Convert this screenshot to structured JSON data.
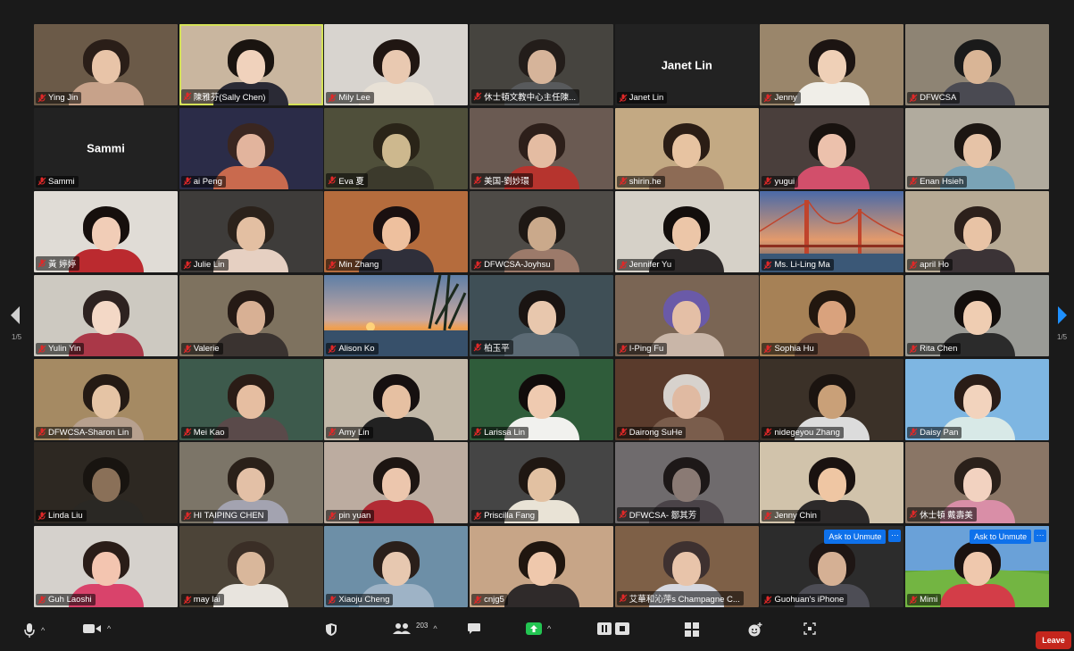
{
  "colors": {
    "active_speaker_border": "#d4e157",
    "unmute_blue": "#0e71eb",
    "leave_red": "#c4261d",
    "muted_mic_red": "#e02828"
  },
  "pagination": {
    "left_page": "1/5",
    "right_page": "1/5"
  },
  "participants": [
    {
      "name": "Ying Jin",
      "bg": "#6b5a48",
      "skin": "#e8c4a8",
      "hair": "#2a1e18",
      "shirt": "#c7a28a"
    },
    {
      "name": "陳雅芬(Sally Chen)",
      "bg": "#c9b69f",
      "skin": "#f0d2bc",
      "hair": "#1a1410",
      "shirt": "#2a2a35",
      "active": true
    },
    {
      "name": "Mily Lee",
      "bg": "#d8d4cf",
      "skin": "#e9c9b1",
      "hair": "#201612",
      "shirt": "#e8e1d6"
    },
    {
      "name": "休士頓文教中心主任陳...",
      "bg": "#46443f",
      "skin": "#d6b49a",
      "hair": "#231d1a",
      "shirt": "#585a5c"
    },
    {
      "name": "Janet Lin",
      "bg": "#222222",
      "center_name": "Janet Lin",
      "no_video": true
    },
    {
      "name": "Jenny",
      "bg": "#9a866b",
      "skin": "#efd0b7",
      "hair": "#1c1412",
      "shirt": "#f0eee8"
    },
    {
      "name": "DFWCSA",
      "bg": "#8e8474",
      "skin": "#d9b596",
      "hair": "#1a1a1a",
      "shirt": "#4a4a52"
    },
    {
      "name": "Sammi",
      "bg": "#222222",
      "center_name": "Sammi",
      "no_video": true
    },
    {
      "name": "ai Peng",
      "bg": "#2b2c48",
      "skin": "#e2b49d",
      "hair": "#3a2620",
      "shirt": "#c96a4e"
    },
    {
      "name": "Eva 夏",
      "bg": "#4f4f3a",
      "skin": "#cdb88e",
      "hair": "#2a2418",
      "shirt": "#3c3a2c"
    },
    {
      "name": "美国-劉妙環",
      "bg": "#6a5a52",
      "skin": "#e4bca2",
      "hair": "#2d1f1a",
      "shirt": "#b6342e"
    },
    {
      "name": "shirin.he",
      "bg": "#c3a983",
      "skin": "#e7c3a1",
      "hair": "#2b1d15",
      "shirt": "#8d6b55"
    },
    {
      "name": "yugui",
      "bg": "#4a3f3c",
      "skin": "#ecc1ac",
      "hair": "#18120f",
      "shirt": "#d24f6b"
    },
    {
      "name": "Enan Hsieh",
      "bg": "#b1ab9e",
      "skin": "#e6c3a7",
      "hair": "#1c1612",
      "shirt": "#7aa3b6"
    },
    {
      "name": "黃 婷婷",
      "bg": "#e0dcd6",
      "skin": "#f1cdb7",
      "hair": "#160f0d",
      "shirt": "#bb2a2f"
    },
    {
      "name": "Julie Lin",
      "bg": "#3e3c3a",
      "skin": "#e3bfa2",
      "hair": "#2b221b",
      "shirt": "#e6d0c2"
    },
    {
      "name": "Min Zhang",
      "bg": "#b56c3d",
      "skin": "#eec09e",
      "hair": "#1a1010",
      "shirt": "#2f2f3a"
    },
    {
      "name": "DFWCSA-Joyhsu",
      "bg": "#4e4b47",
      "skin": "#caa98b",
      "hair": "#1e1814",
      "shirt": "#9c7a6a"
    },
    {
      "name": "Jennifer Yu",
      "bg": "#d6d1c8",
      "skin": "#ecc6a8",
      "hair": "#130e0c",
      "shirt": "#2e2a2a"
    },
    {
      "name": "Ms. Li-Ling Ma",
      "bg": "#5d6f8e",
      "scenery": "bridge"
    },
    {
      "name": "april Ho",
      "bg": "#b7aa95",
      "skin": "#e8c3a5",
      "hair": "#2c201b",
      "shirt": "#3b3336"
    },
    {
      "name": "Yulin Yin",
      "bg": "#cdc9c1",
      "skin": "#f3d8c6",
      "hair": "#2d2220",
      "shirt": "#aa3848"
    },
    {
      "name": "Valerie",
      "bg": "#7e725f",
      "skin": "#d8b094",
      "hair": "#251a15",
      "shirt": "#3a3330"
    },
    {
      "name": "Alison Ko",
      "bg": "#8b95a7",
      "scenery": "sunset"
    },
    {
      "name": "柏玉平",
      "bg": "#3f4f56",
      "skin": "#e8c7ad",
      "hair": "#1a1412",
      "shirt": "#5b6a74"
    },
    {
      "name": "I-Ping Fu",
      "bg": "#7a6554",
      "skin": "#e4bfa6",
      "hair": "#6a5aa8",
      "shirt": "#c9b6a8"
    },
    {
      "name": "Sophia Hu",
      "bg": "#a68156",
      "skin": "#d9a27d",
      "hair": "#22170f",
      "shirt": "#6b4a3a"
    },
    {
      "name": "Rita Chen",
      "bg": "#9a9b96",
      "skin": "#efcdb2",
      "hair": "#130e0c",
      "shirt": "#2b2b2b"
    },
    {
      "name": "DFWCSA-Sharon Lin",
      "bg": "#a58a63",
      "skin": "#e5c4a5",
      "hair": "#241a14",
      "shirt": "#b7a08e"
    },
    {
      "name": "Mei Kao",
      "bg": "#3d5a4c",
      "skin": "#e6bea1",
      "hair": "#2a1c16",
      "shirt": "#5a4a4a"
    },
    {
      "name": "Amy Lin",
      "bg": "#c2b8a8",
      "skin": "#e6c0a2",
      "hair": "#161010",
      "shirt": "#222222"
    },
    {
      "name": "Larissa Lin",
      "bg": "#2f5c3a",
      "skin": "#efcab0",
      "hair": "#110c0b",
      "shirt": "#f1f1ee"
    },
    {
      "name": "Dairong SuHe",
      "bg": "#5a3b2c",
      "skin": "#e0baa2",
      "hair": "#d7d2cd",
      "shirt": "#7a5d4c"
    },
    {
      "name": "nidegeyou Zhang",
      "bg": "#3b3128",
      "skin": "#c9a078",
      "hair": "#1b1410",
      "shirt": "#dcdcdc"
    },
    {
      "name": "Daisy Pan",
      "bg": "#7eb6e2",
      "skin": "#f2d3bd",
      "hair": "#2a1c17",
      "shirt": "#d8e9e7"
    },
    {
      "name": "Linda Liu",
      "bg": "#2d2822",
      "skin": "#8a7058",
      "hair": "#181410",
      "shirt": "#2a2824"
    },
    {
      "name": "HI TAIPING CHEN",
      "bg": "#7c7568",
      "skin": "#e3c0a6",
      "hair": "#2a2019",
      "shirt": "#a3a3b0"
    },
    {
      "name": "pin yuan",
      "bg": "#bcaca0",
      "skin": "#ecc6ad",
      "hair": "#1d1512",
      "shirt": "#b22b34"
    },
    {
      "name": "Priscilla Fang",
      "bg": "#454545",
      "skin": "#e2c1a2",
      "hair": "#1f1712",
      "shirt": "#e9e3d6"
    },
    {
      "name": "DFWCSA- 鄒其芳",
      "bg": "#6f6b6d",
      "skin": "#8a7a74",
      "hair": "#1d1818",
      "shirt": "#4a4348"
    },
    {
      "name": "Jenny Chin",
      "bg": "#d1c3ab",
      "skin": "#efc6a3",
      "hair": "#1a1210",
      "shirt": "#2d2a2a"
    },
    {
      "name": "休士頓 戴壽美",
      "bg": "#8a7666",
      "skin": "#f2d2c0",
      "hair": "#2a201a",
      "shirt": "#d98ea7"
    },
    {
      "name": "Guh Laoshi",
      "bg": "#d5d1cc",
      "skin": "#f3c5b0",
      "hair": "#2a1d18",
      "shirt": "#d9436b"
    },
    {
      "name": "may lai",
      "bg": "#4c4438",
      "skin": "#d9b79b",
      "hair": "#3a2e26",
      "shirt": "#e8e4de"
    },
    {
      "name": "Xiaoju Cheng",
      "bg": "#6d8fa7",
      "skin": "#e7c8b0",
      "hair": "#2a1f1a",
      "shirt": "#9eb3c6"
    },
    {
      "name": "cnjg5",
      "bg": "#c7a587",
      "skin": "#efc8ac",
      "hair": "#20160f",
      "shirt": "#2f2a2a"
    },
    {
      "name": "艾華和沁萍s Champagne C...",
      "bg": "#7e6047",
      "skin": "#e8c4aa",
      "hair": "#3e3130",
      "shirt": "#d6d8e0"
    },
    {
      "name": "Guohuan's iPhone",
      "bg": "#2c2c2c",
      "skin": "#d5b094",
      "hair": "#1e1614",
      "shirt": "#4d4d55",
      "unmute": true
    },
    {
      "name": "Mimi",
      "bg": "#6aa1d8",
      "scenery": "field",
      "skin": "#efc8ad",
      "hair": "#1b1311",
      "shirt": "#d33d48",
      "unmute": true
    }
  ],
  "unmute_label": "Ask to Unmute",
  "more_label": "···",
  "toolbar": {
    "participants_count": "203",
    "leave_label": "Leave"
  }
}
